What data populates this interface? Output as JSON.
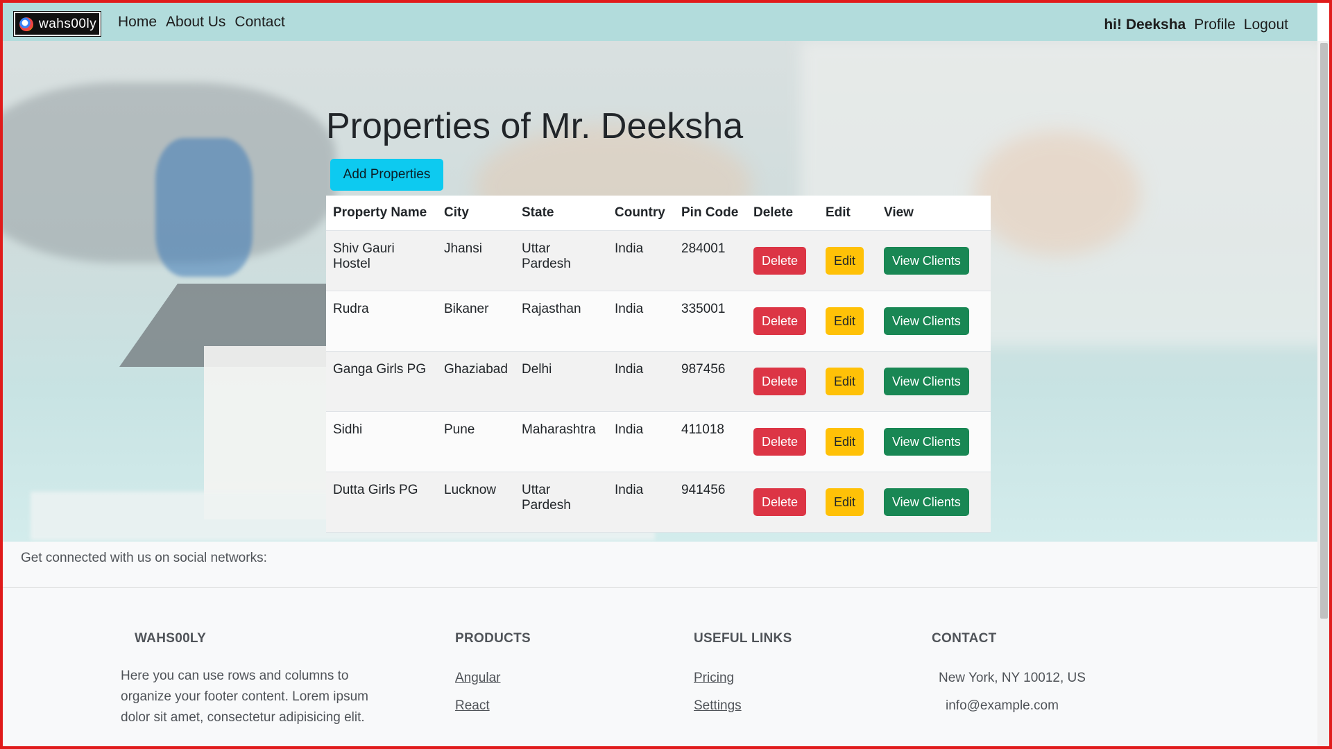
{
  "nav": {
    "brand": "wahs00ly",
    "links": [
      "Home",
      "About Us",
      "Contact"
    ],
    "greeting": "hi! Deeksha",
    "profile": "Profile",
    "logout": "Logout"
  },
  "main": {
    "title": "Properties of Mr. Deeksha",
    "add_button": "Add Properties",
    "columns": [
      "Property Name",
      "City",
      "State",
      "Country",
      "Pin Code",
      "Delete",
      "Edit",
      "View"
    ],
    "rows": [
      {
        "name": "Shiv Gauri Hostel",
        "city": "Jhansi",
        "state": "Uttar Pardesh",
        "country": "India",
        "pin": "284001"
      },
      {
        "name": "Rudra",
        "city": "Bikaner",
        "state": "Rajasthan",
        "country": "India",
        "pin": "335001"
      },
      {
        "name": "Ganga Girls PG",
        "city": "Ghaziabad",
        "state": "Delhi",
        "country": "India",
        "pin": "987456"
      },
      {
        "name": "Sidhi",
        "city": "Pune",
        "state": "Maharashtra",
        "country": "India",
        "pin": "411018"
      },
      {
        "name": "Dutta Girls PG",
        "city": "Lucknow",
        "state": "Uttar Pardesh",
        "country": "India",
        "pin": "941456"
      }
    ],
    "delete_label": "Delete",
    "edit_label": "Edit",
    "view_label": "View Clients"
  },
  "footer": {
    "social_text": "Get connected with us on social networks:",
    "company": {
      "heading": "WAHS00LY",
      "text": "Here you can use rows and columns to organize your footer content. Lorem ipsum dolor sit amet, consectetur adipisicing elit."
    },
    "products": {
      "heading": "PRODUCTS",
      "links": [
        "Angular",
        "React"
      ]
    },
    "useful": {
      "heading": "USEFUL LINKS",
      "links": [
        "Pricing",
        "Settings"
      ]
    },
    "contact": {
      "heading": "CONTACT",
      "address": "New York, NY 10012, US",
      "email": "info@example.com"
    }
  },
  "colors": {
    "navbar": "#b2dcdc",
    "add_button": "#0dcaf0",
    "danger": "#dc3545",
    "warning": "#ffc107",
    "success": "#198754"
  }
}
